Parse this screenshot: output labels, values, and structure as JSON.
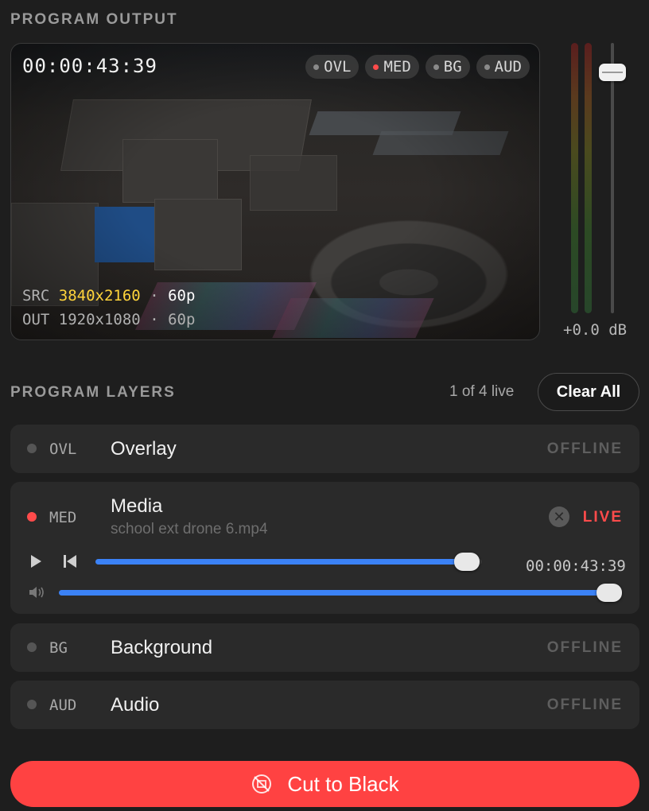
{
  "program_output": {
    "section_title": "PROGRAM OUTPUT",
    "timecode": "00:00:43:39",
    "badges": [
      {
        "label": "OVL",
        "live": false
      },
      {
        "label": "MED",
        "live": true
      },
      {
        "label": "BG",
        "live": false
      },
      {
        "label": "AUD",
        "live": false
      }
    ],
    "src_label": "SRC",
    "src_resolution": "3840x2160",
    "src_separator": "·",
    "src_rate": "60p",
    "out_label": "OUT",
    "out_resolution": "1920x1080",
    "out_separator": "·",
    "out_rate": "60p",
    "gain_readout": "+0.0 dB"
  },
  "program_layers": {
    "section_title": "PROGRAM LAYERS",
    "live_count": "1 of 4 live",
    "clear_all_label": "Clear All",
    "layers": [
      {
        "code": "OVL",
        "name": "Overlay",
        "status": "OFFLINE",
        "live": false
      },
      {
        "code": "MED",
        "name": "Media",
        "file": "school ext drone 6.mp4",
        "status": "LIVE",
        "live": true,
        "time": "00:00:43:39",
        "progress": 0.96,
        "volume": 1.0
      },
      {
        "code": "BG",
        "name": "Background",
        "status": "OFFLINE",
        "live": false
      },
      {
        "code": "AUD",
        "name": "Audio",
        "status": "OFFLINE",
        "live": false
      }
    ]
  },
  "cut_to_black_label": "Cut to Black",
  "colors": {
    "accent_live": "#ff4b4b",
    "accent_blue": "#3b82f6",
    "src_highlight": "#ffd43b",
    "cut_button": "#ff4242"
  },
  "icons": [
    "play-icon",
    "skip-back-icon",
    "volume-icon",
    "close-icon",
    "no-signal-icon"
  ]
}
